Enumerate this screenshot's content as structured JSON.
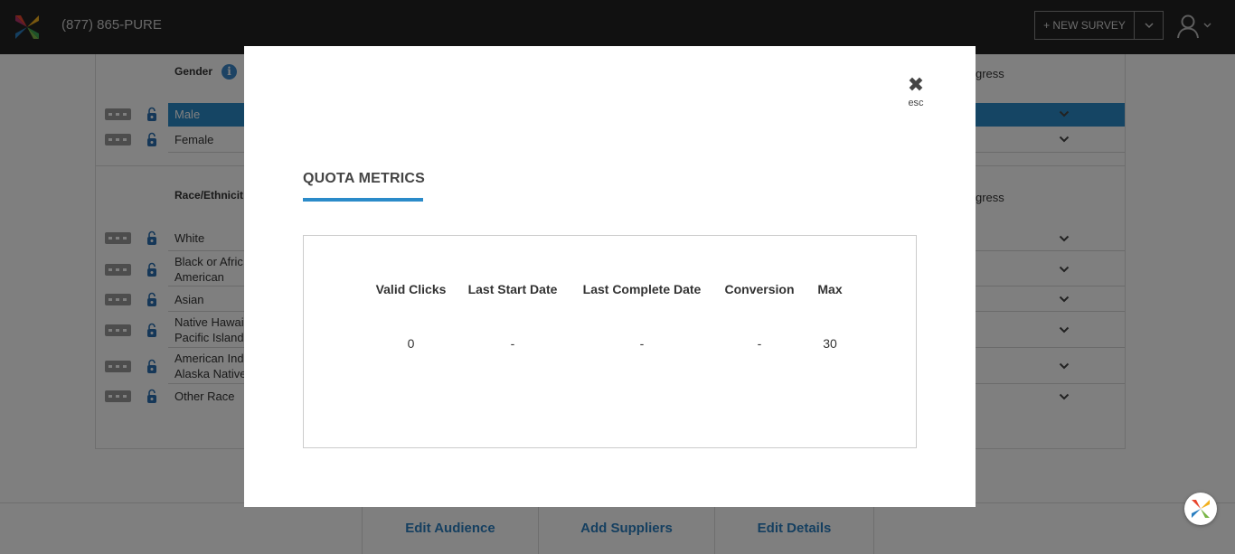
{
  "header": {
    "phone": "(877) 865-PURE",
    "new_survey_label": "+ NEW SURVEY"
  },
  "background": {
    "gender": {
      "heading": "Gender",
      "progress_heading": "gress",
      "rows": [
        {
          "label": "Male",
          "selected": true
        },
        {
          "label": "Female",
          "selected": false
        }
      ]
    },
    "race": {
      "heading": "Race/Ethnicit",
      "progress_heading": "gress",
      "rows": [
        {
          "label": "White"
        },
        {
          "label_1": "Black or Afric",
          "label_2": "American"
        },
        {
          "label": "Asian"
        },
        {
          "label_1": "Native Hawaii",
          "label_2": "Pacific Islande"
        },
        {
          "label_1": "American Indi",
          "label_2": "Alaska Native"
        },
        {
          "label": "Other Race"
        }
      ]
    },
    "bottom_tabs": [
      "Edit Audience",
      "Add Suppliers",
      "Edit Details"
    ]
  },
  "modal": {
    "close_label": "esc",
    "title": "QUOTA METRICS",
    "columns": [
      "Valid Clicks",
      "Last Start Date",
      "Last Complete Date",
      "Conversion",
      "Max"
    ],
    "values": [
      "0",
      "-",
      "-",
      "-",
      "30"
    ]
  },
  "icons": {
    "logo": "x-logo-icon",
    "info": "info-icon",
    "lock": "lock-icon",
    "user": "user-icon",
    "close": "close-icon",
    "chevron": "chevron-down-icon"
  },
  "colors": {
    "accent": "#2b8bc9",
    "topbar": "#222222",
    "link": "#2b7fc0"
  }
}
